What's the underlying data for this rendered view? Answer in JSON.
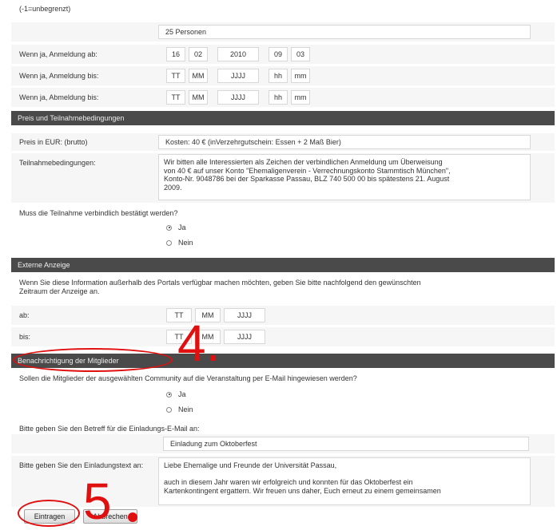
{
  "top": {
    "unlimited_note": "(-1=unbegrenzt)",
    "persons_value": "25 Personen"
  },
  "registration": {
    "from_label": "Wenn ja, Anmeldung ab:",
    "from": {
      "day": "16",
      "month": "02",
      "year": "2010",
      "hour": "09",
      "minute": "03"
    },
    "until_label": "Wenn ja, Anmeldung bis:",
    "until": {
      "day": "TT",
      "month": "MM",
      "year": "JJJJ",
      "hour": "hh",
      "minute": "mm"
    },
    "cancel_label": "Wenn ja, Abmeldung bis:",
    "cancel": {
      "day": "TT",
      "month": "MM",
      "year": "JJJJ",
      "hour": "hh",
      "minute": "mm"
    }
  },
  "price_section": {
    "header": "Preis und Teilnahmebedingungen",
    "price_label": "Preis in EUR: (brutto)",
    "price_value": "Kosten: 40 € (inVerzehrgutschein: Essen + 2 Maß Bier)",
    "conditions_label": "Teilnahmebedingungen:",
    "conditions_value": "Wir bitten alle Interessierten als Zeichen der verbindlichen Anmeldung um Überweisung\nvon 40 € auf unser Konto \"Ehemaligenverein - Verrechnungskonto Stammtisch München\",\nKonto-Nr. 9048786 bei der Sparkasse Passau, BLZ 740 500 00 bis spätestens 21. August\n2009.",
    "confirm_question": "Muss die Teilnahme verbindlich bestätigt werden?",
    "yes": "Ja",
    "no": "Nein"
  },
  "external_section": {
    "header": "Externe Anzeige",
    "description": "Wenn Sie diese Information außerhalb des Portals verfügbar machen möchten, geben Sie bitte nachfolgend den gewünschten\nZeitraum der Anzeige an.",
    "from_label": "ab:",
    "until_label": "bis:",
    "date_placeholder": {
      "day": "TT",
      "month": "MM",
      "year": "JJJJ"
    }
  },
  "notify_section": {
    "header": "Benachrichtigung der Mitglieder",
    "question": "Sollen die Mitglieder der ausgewählten Community auf die Veranstaltung per E-Mail hingewiesen werden?",
    "yes": "Ja",
    "no": "Nein",
    "subject_label": "Bitte geben Sie den Betreff für die Einladungs-E-Mail an:",
    "subject_value": "Einladung zum Oktoberfest",
    "text_label": "Bitte geben Sie den Einladungstext an:",
    "text_value": "Liebe Ehemalige und Freunde der Universität Passau,\n\nauch in diesem Jahr waren wir erfolgreich und konnten für das Oktoberfest ein\nKartenkontingent ergattern. Wir freuen uns daher, Euch erneut zu einem gemeinsamen"
  },
  "buttons": {
    "submit": "Eintragen",
    "cancel": "Abbrechen"
  },
  "annotations": {
    "step4": "4.",
    "step5": "5",
    "color": "#e01010"
  },
  "colors": {
    "section_bar": "#4a4a4a",
    "row_bg": "#f6f6f6"
  }
}
